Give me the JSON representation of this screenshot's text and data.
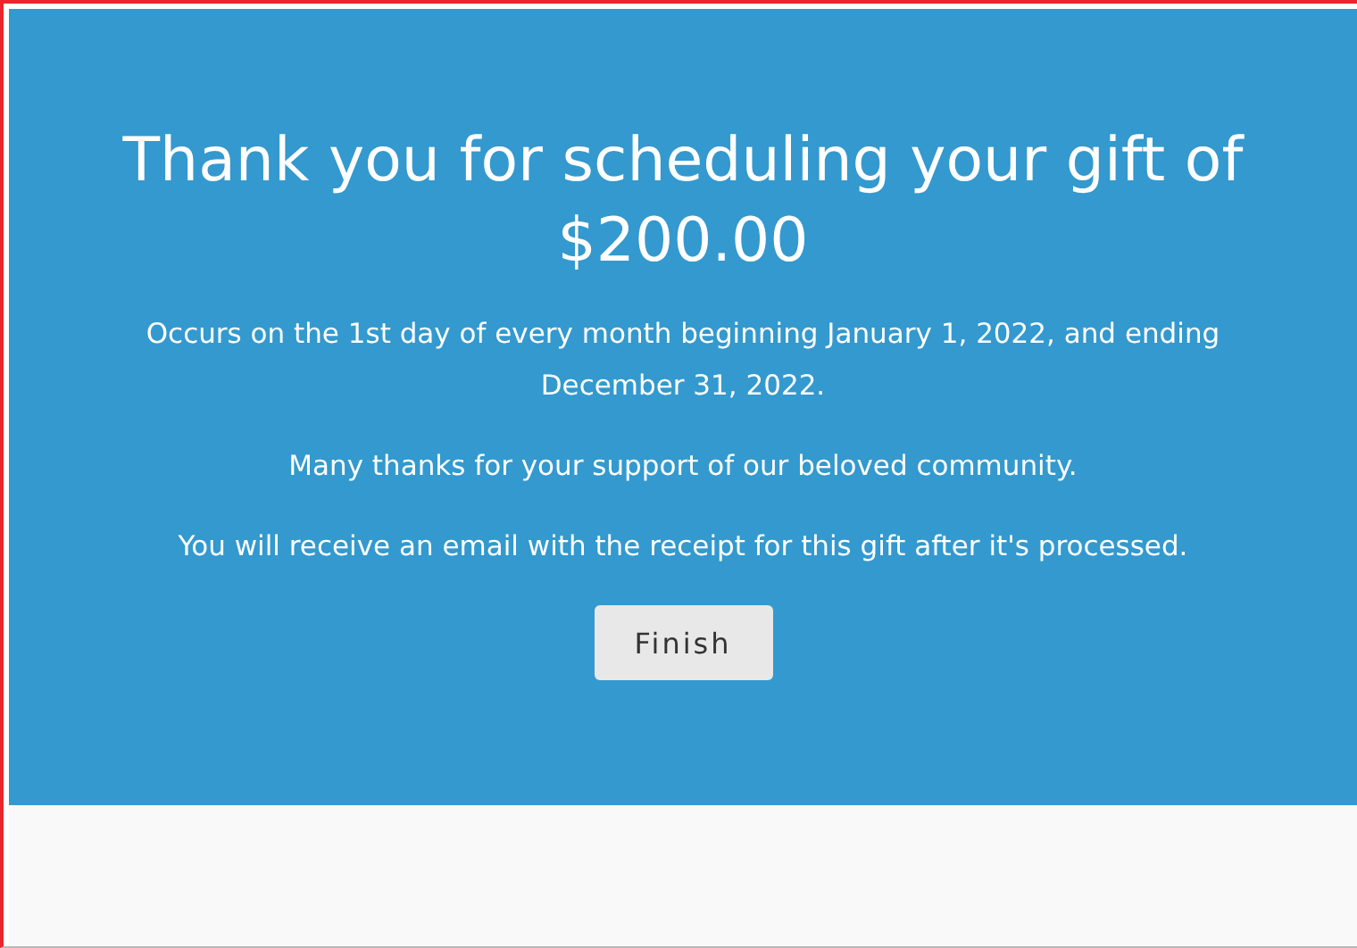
{
  "confirmation": {
    "title": "Thank you for scheduling your gift of",
    "amount": "$200.00",
    "paragraphs": [
      "Occurs on the 1st day of every month beginning January 1, 2022, and ending December 31, 2022.",
      "Many thanks for your support of our beloved community.",
      "You will receive an email with the receipt for this gift after it's processed."
    ],
    "button": "Finish"
  }
}
